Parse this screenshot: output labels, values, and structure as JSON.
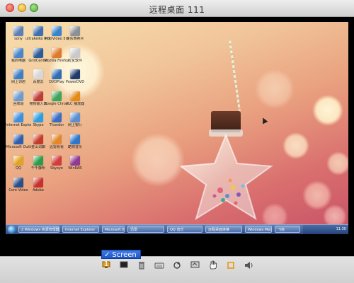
{
  "window": {
    "title": "远程桌面  111"
  },
  "desktop": {
    "icons": [
      {
        "label": "sony",
        "color": "#5b7fb6"
      },
      {
        "label": "ultrakeiko 中文版",
        "color": "#3f6fb0"
      },
      {
        "label": "InterVideo 5.0.1",
        "color": "#3a83c9"
      },
      {
        "label": "好东西照片",
        "color": "#8b8f96"
      },
      {
        "label": "我的电脑",
        "color": "#4a86c8"
      },
      {
        "label": "GridCenter",
        "color": "#2a5c9a"
      },
      {
        "label": "Mozilla Firefox",
        "color": "#e07a2a"
      },
      {
        "label": "优化软件",
        "color": "#c9c9c9"
      },
      {
        "label": "网上邻居",
        "color": "#3d7fc5"
      },
      {
        "label": "百度云",
        "color": "#d7d7d7"
      },
      {
        "label": "DVDPlay",
        "color": "#2f6db5"
      },
      {
        "label": "PowerDVD",
        "color": "#1f3b6a"
      },
      {
        "label": "回收站",
        "color": "#6b9bd1"
      },
      {
        "label": "搜狗输入法",
        "color": "#c23b3b"
      },
      {
        "label": "Google Chrome",
        "color": "#3ba55b"
      },
      {
        "label": "VLC 播放器",
        "color": "#e58b1d"
      },
      {
        "label": "Internet Explorer",
        "color": "#3d8fe0"
      },
      {
        "label": "Skype",
        "color": "#2d9ee0"
      },
      {
        "label": "Thunder",
        "color": "#3a6ec2"
      },
      {
        "label": "网上银行",
        "color": "#5b8fd0"
      },
      {
        "label": "Microsoft Outlook",
        "color": "#2d5fae"
      },
      {
        "label": "金山词霸",
        "color": "#c63a2a"
      },
      {
        "label": "迅雷看看",
        "color": "#e2872a"
      },
      {
        "label": "酷狗音乐",
        "color": "#2f76c8"
      },
      {
        "label": "QQ",
        "color": "#e0a324"
      },
      {
        "label": "千千静听",
        "color": "#2c9c4a"
      },
      {
        "label": "Skyeye",
        "color": "#d23c3c"
      },
      {
        "label": "WinRAR",
        "color": "#8f3b8f"
      },
      {
        "label": "Core Video",
        "color": "#2a4f86"
      },
      {
        "label": "Adobe",
        "color": "#c7302b"
      }
    ]
  },
  "taskbar": {
    "start_label": "开始",
    "buttons": [
      "2 Windows 资源管理器",
      "Internet Explorer",
      "Microsoft Word",
      "迅雷",
      "QQ 音乐",
      "远程桌面连接",
      "Windows Media",
      "飞信"
    ],
    "clock": "11:30"
  },
  "toolbar": {
    "screen_menu": {
      "check": "✓",
      "label": "Screen 1"
    },
    "icons": [
      "screen-select-icon",
      "display-icon",
      "trash-icon",
      "keyboard-icon",
      "refresh-icon",
      "fullscreen-icon",
      "hand-icon",
      "crop-icon",
      "speaker-icon"
    ]
  },
  "colors": {
    "accent": "#1d55c5",
    "taskbar": "#2f4f86"
  }
}
